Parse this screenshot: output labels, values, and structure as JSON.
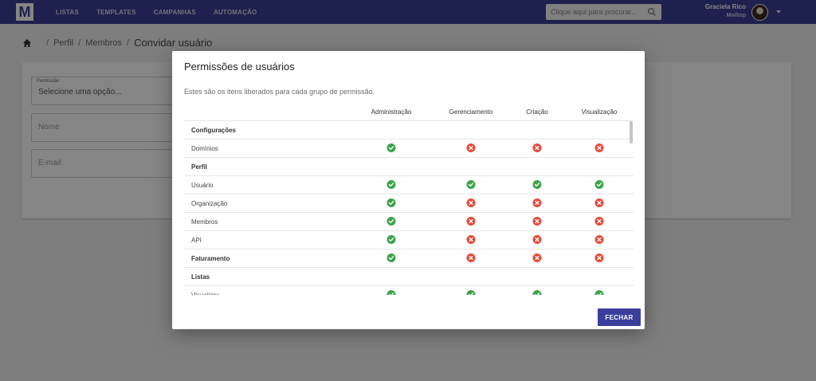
{
  "nav": {
    "logo_letter": "M",
    "items": [
      "LISTAS",
      "TEMPLATES",
      "CAMPANHAS",
      "AUTOMAÇÃO"
    ]
  },
  "search": {
    "placeholder": "Clique aqui para procurar..."
  },
  "user": {
    "name": "Graciela Rico",
    "subtitle": "Mailtop"
  },
  "breadcrumb": {
    "items": [
      "Perfil",
      "Membros"
    ],
    "current": "Convidar usuário"
  },
  "form": {
    "permission_label": "Permissão",
    "permission_value": "Selecione uma opção...",
    "name_placeholder": "Nome",
    "email_placeholder": "E-mail"
  },
  "dialog": {
    "title": "Permissões de usuários",
    "description": "Estes são os itens liberados para cada grupo de permissão.",
    "columns": [
      "Administração",
      "Gerenciamento",
      "Criação",
      "Visualização"
    ],
    "rows": [
      {
        "label": "Configurações",
        "section": true,
        "perms": []
      },
      {
        "label": "Domínios",
        "section": false,
        "perms": [
          true,
          false,
          false,
          false
        ]
      },
      {
        "label": "Perfil",
        "section": true,
        "perms": []
      },
      {
        "label": "Usuário",
        "section": false,
        "perms": [
          true,
          true,
          true,
          true
        ]
      },
      {
        "label": "Organização",
        "section": false,
        "perms": [
          true,
          false,
          false,
          false
        ]
      },
      {
        "label": "Membros",
        "section": false,
        "perms": [
          true,
          false,
          false,
          false
        ]
      },
      {
        "label": "API",
        "section": false,
        "perms": [
          true,
          false,
          false,
          false
        ]
      },
      {
        "label": "Faturamento",
        "section": true,
        "perms": [
          true,
          false,
          false,
          false
        ]
      },
      {
        "label": "Listas",
        "section": true,
        "perms": []
      },
      {
        "label": "Visualizar",
        "section": false,
        "perms": [
          true,
          true,
          true,
          true
        ]
      }
    ],
    "close_label": "FECHAR"
  },
  "colors": {
    "topbar": "#3b3f94",
    "primary_button": "#3a3f9e",
    "allowed": "#3fa34d",
    "denied": "#e84a3a"
  }
}
